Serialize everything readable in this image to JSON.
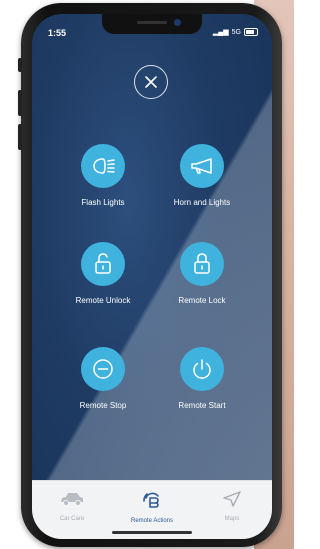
{
  "status_bar": {
    "time": "1:55",
    "network": "5G"
  },
  "actions": [
    {
      "label": "Flash Lights",
      "icon": "headlights-icon"
    },
    {
      "label": "Horn and Lights",
      "icon": "horn-icon"
    },
    {
      "label": "Remote Unlock",
      "icon": "unlocked-padlock-icon"
    },
    {
      "label": "Remote Lock",
      "icon": "locked-padlock-icon"
    },
    {
      "label": "Remote Stop",
      "icon": "stop-minus-icon"
    },
    {
      "label": "Remote Start",
      "icon": "power-icon"
    }
  ],
  "tabs": [
    {
      "label": "Car Care",
      "icon": "car-icon",
      "active": false
    },
    {
      "label": "Remote Actions",
      "icon": "remote-actions-icon",
      "active": true
    },
    {
      "label": "Maps",
      "icon": "navigation-arrow-icon",
      "active": false
    }
  ],
  "colors": {
    "accent": "#3fb2de",
    "background": "#1e3b63",
    "tab_active": "#2e5c96",
    "tab_inactive": "#a9adb3"
  }
}
